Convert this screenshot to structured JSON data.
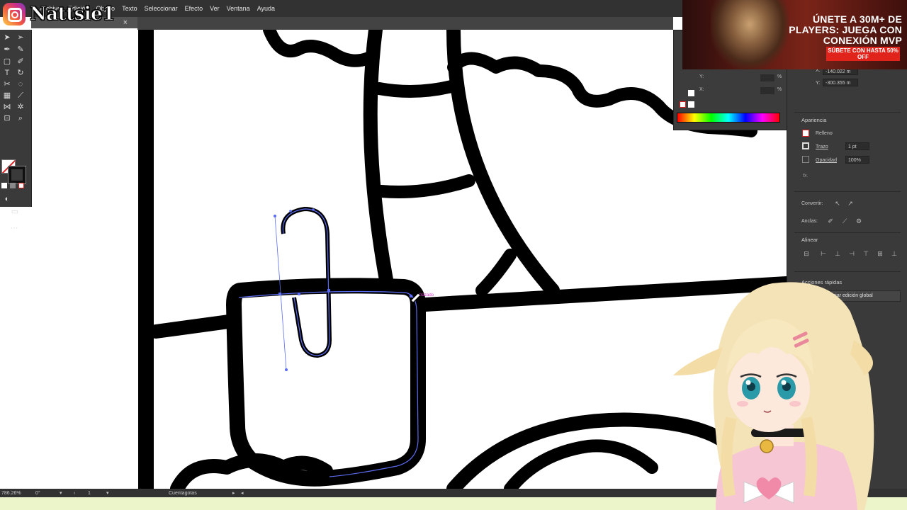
{
  "brand": {
    "handle": "Nattsie1"
  },
  "menu": {
    "items": [
      "Archivo",
      "Edición",
      "Objeto",
      "Texto",
      "Seleccionar",
      "Efecto",
      "Ver",
      "Ventana",
      "Ayuda"
    ]
  },
  "doc_tab": {
    "close": "×"
  },
  "ad": {
    "headline": "ÚNETE A 30M+ DE PLAYERS: JUEGA CON CONEXIÓN MVP",
    "cta": "SÚBETE CON HASTA 50% OFF",
    "colors": {
      "cta": "#e0241c",
      "bg": "#5a1812"
    }
  },
  "color_panel": {
    "y_label": "Y:",
    "y_value": "-300.355 m",
    "x_label": "X:",
    "x_value": "-140.022 m",
    "pct": "%"
  },
  "properties": {
    "appearance": {
      "title": "Apariencia",
      "fill_label": "Relleno",
      "stroke_label": "Trazo",
      "stroke_weight": "1 pt",
      "opacity_label": "Opacidad",
      "opacity_value": "100%",
      "fx": "fx."
    },
    "convert_label": "Convertir:",
    "anchors_label": "Anclas:",
    "align_title": "Alinear",
    "quick_actions": {
      "title": "Acciones rápidas",
      "global_edit_button": "Iniciar edición global"
    }
  },
  "canvas": {
    "cursor_hint": "trazado",
    "colors": {
      "path_selection": "#5b6cf0",
      "stroke": "#000000"
    }
  },
  "status": {
    "zoom": "786.26%",
    "rotation": "0°",
    "artboard": "1",
    "tool_name": "Cuentagotas"
  }
}
